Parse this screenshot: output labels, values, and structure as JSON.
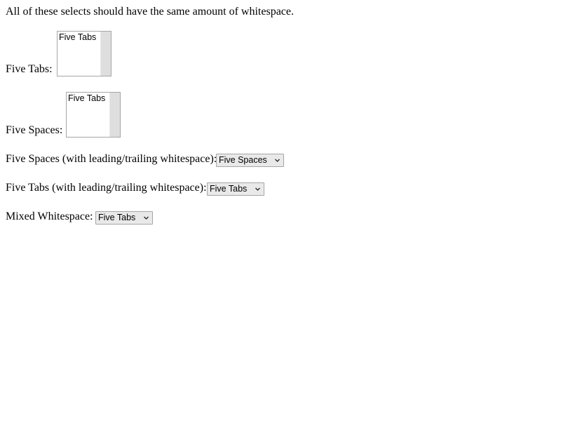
{
  "intro": "All of these selects should have the same amount of whitespace.",
  "rows": [
    {
      "label": "Five Tabs:",
      "selected": "Five Tabs"
    },
    {
      "label": "Five Spaces:",
      "selected": "Five Tabs"
    },
    {
      "label": "Five Spaces (with leading/trailing whitespace):",
      "selected": "Five Spaces"
    },
    {
      "label": "Five Tabs (with leading/trailing whitespace):",
      "selected": "Five Tabs"
    },
    {
      "label": "Mixed Whitespace:",
      "selected": "Five Tabs"
    }
  ],
  "icons": {
    "dropdown_arrow": "chevron-down-icon"
  }
}
